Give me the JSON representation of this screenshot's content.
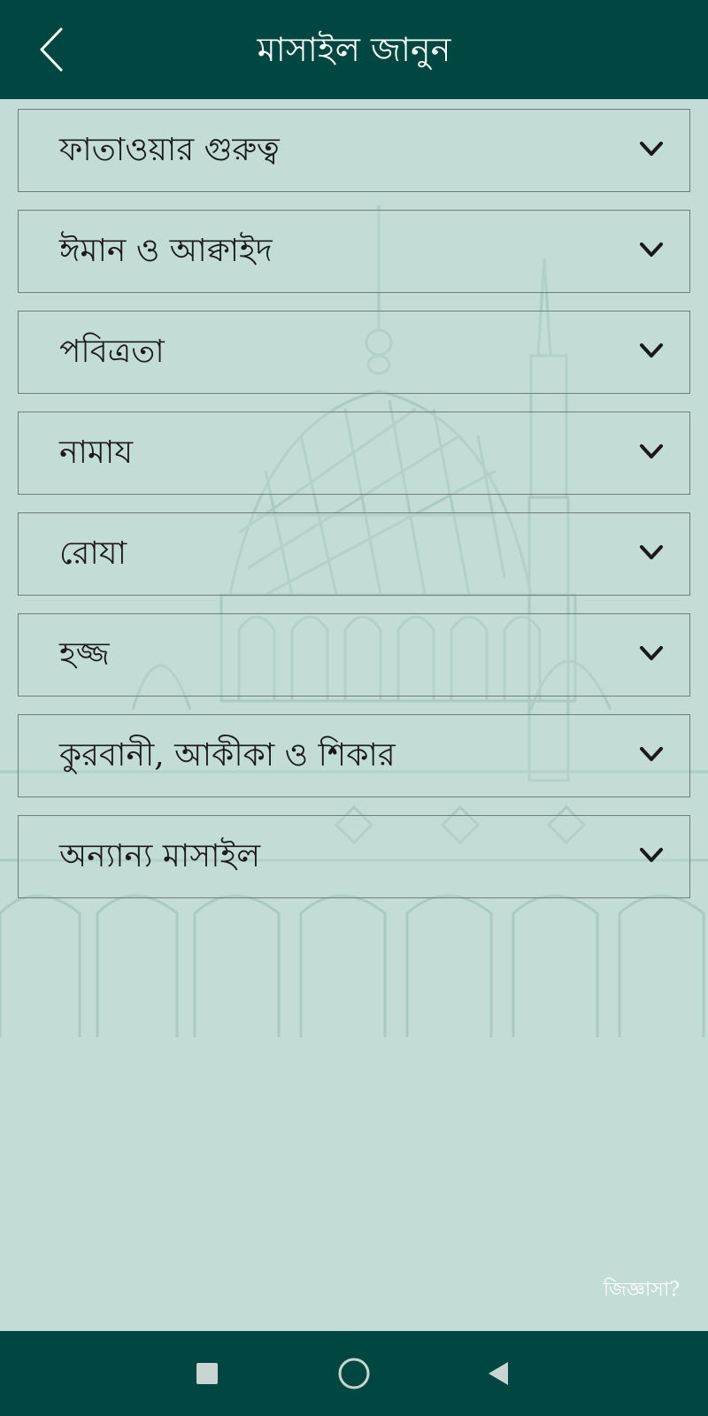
{
  "app_bar": {
    "title": "মাসাইল জানুন",
    "back_icon": "chevron-left-icon"
  },
  "categories": [
    {
      "label": "ফাতাওয়ার গুরুত্ব",
      "icon": "chevron-down-icon"
    },
    {
      "label": "ঈমান ও আক্বাইদ",
      "icon": "chevron-down-icon"
    },
    {
      "label": "পবিত্রতা",
      "icon": "chevron-down-icon"
    },
    {
      "label": "নামায",
      "icon": "chevron-down-icon"
    },
    {
      "label": "রোযা",
      "icon": "chevron-down-icon"
    },
    {
      "label": "হজ্জ",
      "icon": "chevron-down-icon"
    },
    {
      "label": "কুরবানী, আকীকা ও শিকার",
      "icon": "chevron-down-icon"
    },
    {
      "label": "অন্যান্য মাসাইল",
      "icon": "chevron-down-icon"
    }
  ],
  "ask_link": "জিজ্ঞাসা?",
  "nav": {
    "recents_icon": "square-icon",
    "home_icon": "circle-icon",
    "back_icon": "triangle-left-icon"
  },
  "colors": {
    "primary": "#004741",
    "background": "#c3dcd7",
    "border": "#6f7e7b"
  }
}
